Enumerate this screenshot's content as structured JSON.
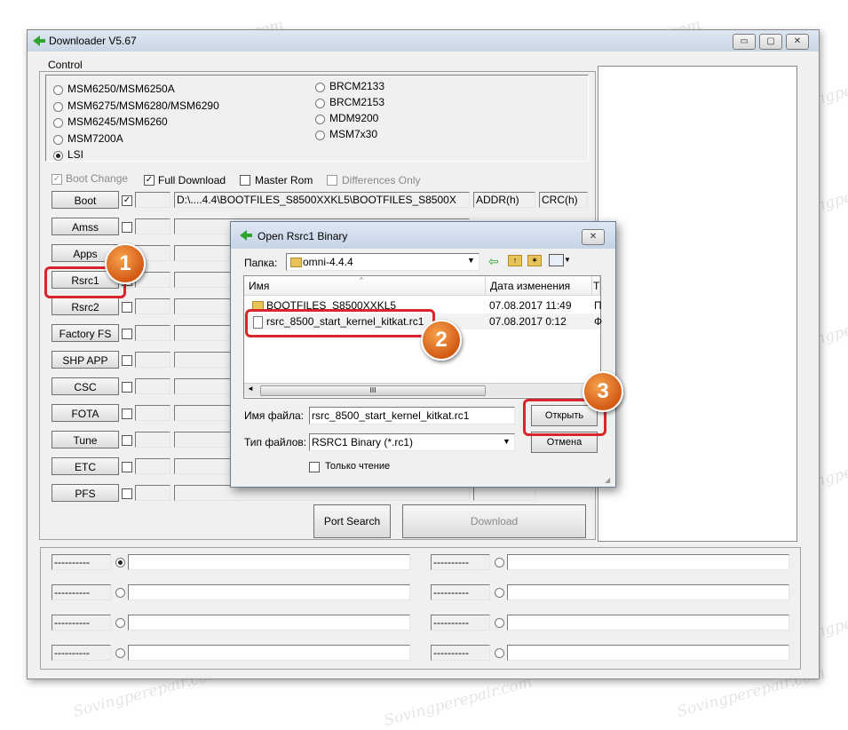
{
  "window": {
    "title": "Downloader V5.67",
    "controls": [
      "▭",
      "▢",
      "✕"
    ]
  },
  "control": {
    "legend": "Control",
    "radios_left": [
      {
        "label": "MSM6250/MSM6250A",
        "checked": false
      },
      {
        "label": "MSM6275/MSM6280/MSM6290",
        "checked": false
      },
      {
        "label": "MSM6245/MSM6260",
        "checked": false
      },
      {
        "label": "MSM7200A",
        "checked": false
      },
      {
        "label": "LSI",
        "checked": true
      }
    ],
    "radios_right": [
      {
        "label": "BRCM2133",
        "checked": false
      },
      {
        "label": "BRCM2153",
        "checked": false
      },
      {
        "label": "MDM9200",
        "checked": false
      },
      {
        "label": "MSM7x30",
        "checked": false
      }
    ]
  },
  "options": {
    "boot_change": "Boot Change",
    "full_download": "Full Download",
    "master_rom": "Master Rom",
    "differences_only": "Differences Only"
  },
  "rows": [
    {
      "label": "Boot",
      "checked": true,
      "path": "D:\\....4.4\\BOOTFILES_S8500XXKL5\\BOOTFILES_S8500X"
    },
    {
      "label": "Amss",
      "checked": false,
      "path": ""
    },
    {
      "label": "Apps",
      "checked": false,
      "path": ""
    },
    {
      "label": "Rsrc1",
      "checked": false,
      "path": ""
    },
    {
      "label": "Rsrc2",
      "checked": false,
      "path": ""
    },
    {
      "label": "Factory FS",
      "checked": false,
      "path": ""
    },
    {
      "label": "SHP APP",
      "checked": false,
      "path": ""
    },
    {
      "label": "CSC",
      "checked": false,
      "path": ""
    },
    {
      "label": "FOTA",
      "checked": false,
      "path": ""
    },
    {
      "label": "Tune",
      "checked": false,
      "path": ""
    },
    {
      "label": "ETC",
      "checked": false,
      "path": ""
    },
    {
      "label": "PFS",
      "checked": false,
      "path": ""
    }
  ],
  "addr_label": "ADDR(h)",
  "crc_label": "CRC(h)",
  "port_search": "Port Search",
  "download": "Download",
  "ports": {
    "left": [
      {
        "label": "----------",
        "selected": true
      },
      {
        "label": "----------",
        "selected": false
      },
      {
        "label": "----------",
        "selected": false
      },
      {
        "label": "----------",
        "selected": false
      }
    ],
    "right": [
      {
        "label": "----------",
        "selected": false
      },
      {
        "label": "----------",
        "selected": false
      },
      {
        "label": "----------",
        "selected": false
      },
      {
        "label": "----------",
        "selected": false
      }
    ]
  },
  "dialog": {
    "title": "Open Rsrc1 Binary",
    "folder_label": "Папка:",
    "folder_value": "omni-4.4.4",
    "col_name": "Имя",
    "col_date": "Дата изменения",
    "col_type": "Т",
    "files": [
      {
        "name": "BOOTFILES_S8500XXKL5",
        "date": "07.08.2017 11:49",
        "type": "П",
        "kind": "folder"
      },
      {
        "name": "rsrc_8500_start_kernel_kitkat.rc1",
        "date": "07.08.2017 0:12",
        "type": "Ф",
        "kind": "file"
      }
    ],
    "filename_label": "Имя файла:",
    "filename_value": "rsrc_8500_start_kernel_kitkat.rc1",
    "filetype_label": "Тип файлов:",
    "filetype_value": "RSRC1 Binary (*.rc1)",
    "readonly_label": "Только чтение",
    "open_button": "Открыть",
    "cancel_button": "Отмена",
    "scroll_mark": "III"
  },
  "callouts": [
    "1",
    "2",
    "3"
  ],
  "watermark": "Sovingperepair.com",
  "colors": {
    "accent": "#d7272d",
    "callout": "#e07020",
    "arrow": "#2fa52f"
  }
}
